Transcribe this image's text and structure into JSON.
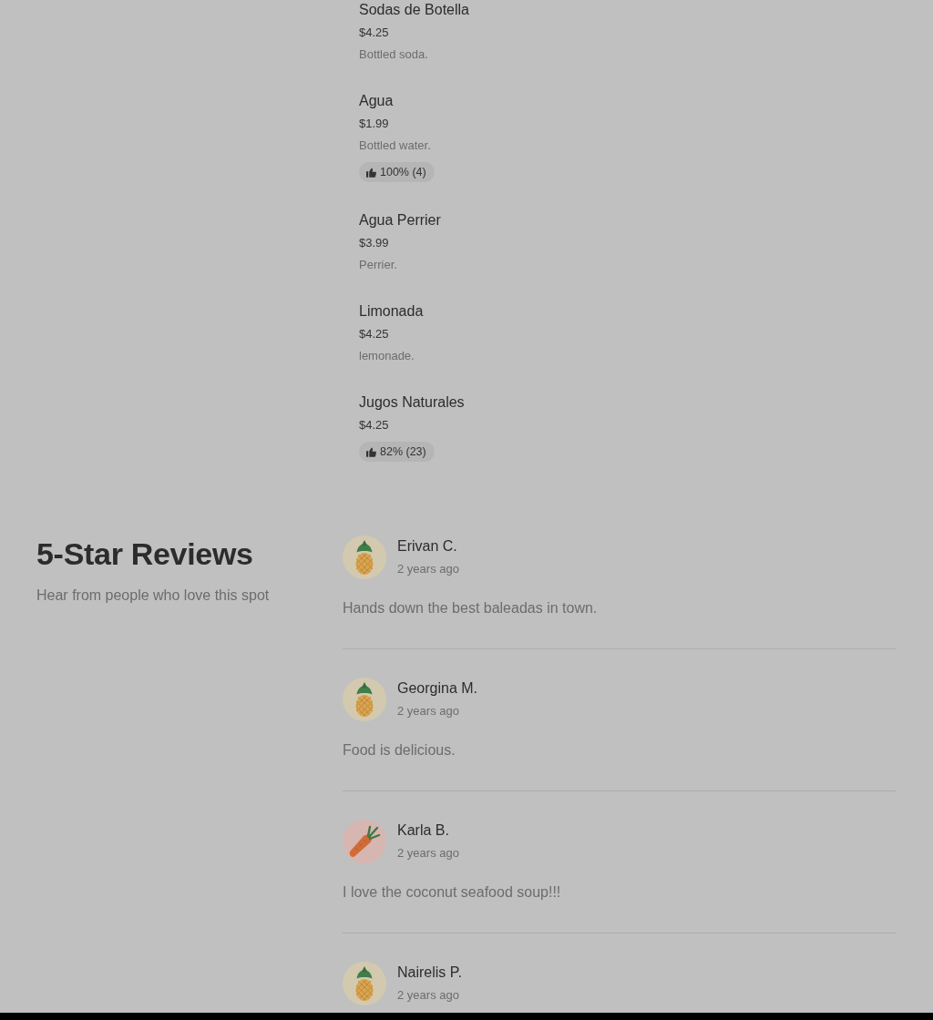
{
  "menu_items": [
    {
      "name": "Sodas de Botella",
      "price": "$4.25",
      "description": "Bottled soda."
    },
    {
      "name": "Agua",
      "price": "$1.99",
      "description": "Bottled water.",
      "rating": "100% (4)"
    },
    {
      "name": "Agua Perrier",
      "price": "$3.99",
      "description": "Perrier."
    },
    {
      "name": "Limonada",
      "price": "$4.25",
      "description": "lemonade."
    },
    {
      "name": "Jugos Naturales",
      "price": "$4.25",
      "rating": "82% (23)"
    }
  ],
  "reviews": {
    "title": "5-Star Reviews",
    "subtitle": "Hear from people who love this spot",
    "items": [
      {
        "avatar": {
          "kind": "pineapple"
        },
        "name": "Erivan C.",
        "date": "2 years ago",
        "text": "Hands down the best baleadas in town."
      },
      {
        "avatar": {
          "kind": "pineapple"
        },
        "name": "Georgina M.",
        "date": "2 years ago",
        "text": "Food is delicious."
      },
      {
        "avatar": {
          "kind": "carrot"
        },
        "name": "Karla B.",
        "date": "2 years ago",
        "text": "I love the coconut seafood soup!!!"
      },
      {
        "avatar": {
          "kind": "pineapple"
        },
        "name": "Nairelis P.",
        "date": "2 years ago"
      }
    ]
  }
}
